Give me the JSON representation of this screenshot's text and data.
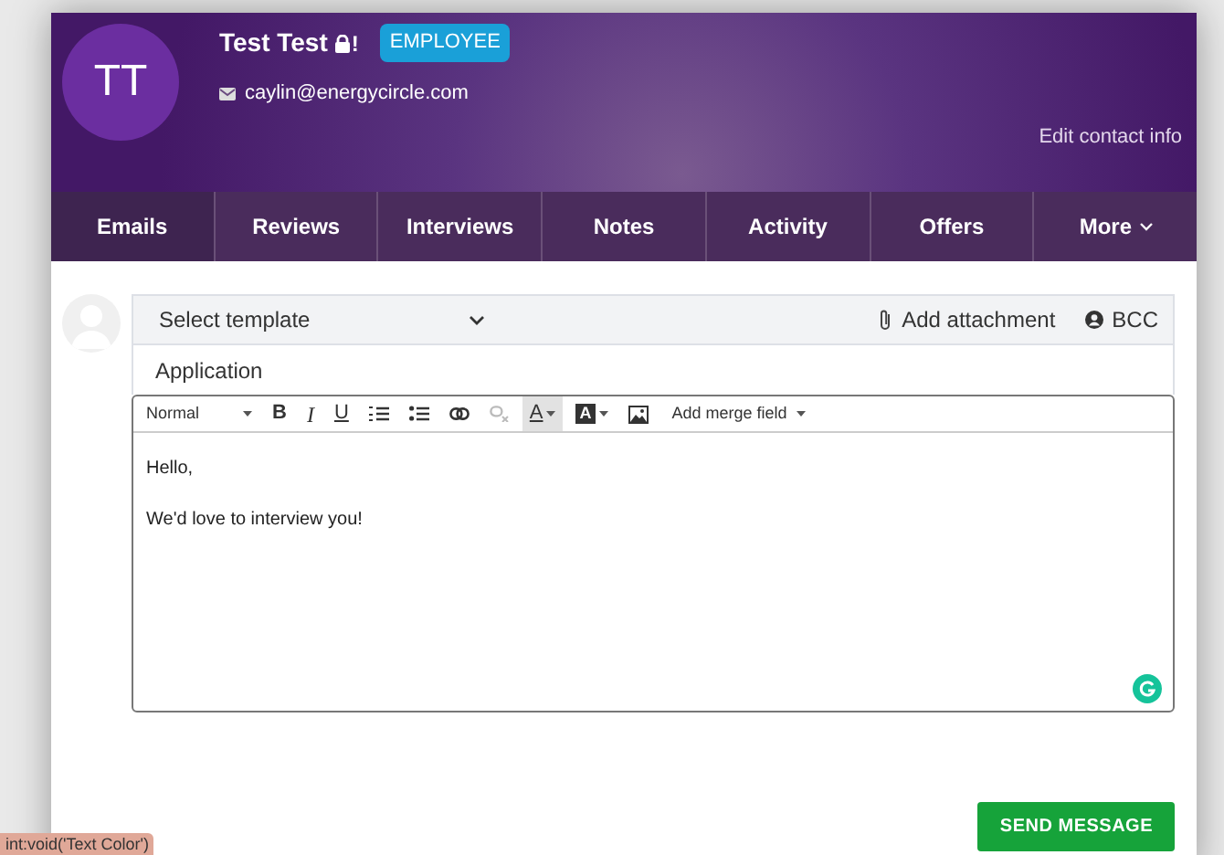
{
  "header": {
    "avatar_initials": "TT",
    "name": "Test Test",
    "locked_mark": "!",
    "badge": "EMPLOYEE",
    "email": "caylin@energycircle.com",
    "edit_link": "Edit contact info"
  },
  "tabs": [
    {
      "label": "Emails",
      "selected": true
    },
    {
      "label": "Reviews",
      "selected": false
    },
    {
      "label": "Interviews",
      "selected": false
    },
    {
      "label": "Notes",
      "selected": false
    },
    {
      "label": "Activity",
      "selected": false
    },
    {
      "label": "Offers",
      "selected": false
    },
    {
      "label": "More",
      "selected": false,
      "dropdown": true
    }
  ],
  "composer": {
    "template": "Select template",
    "attachment": "Add attachment",
    "bcc": "BCC",
    "subject": "Application",
    "toolbar": [
      {
        "kind": "format",
        "label": "Normal"
      },
      {
        "kind": "bold",
        "label": "B",
        "active": false,
        "disabled": false
      },
      {
        "kind": "italic",
        "label": "I",
        "active": false,
        "disabled": false
      },
      {
        "kind": "underline",
        "label": "U",
        "active": false,
        "disabled": false
      },
      {
        "kind": "ordered-list",
        "active": false,
        "disabled": false
      },
      {
        "kind": "bullet-list",
        "active": false,
        "disabled": false
      },
      {
        "kind": "link",
        "active": false,
        "disabled": false
      },
      {
        "kind": "unlink",
        "active": false,
        "disabled": true
      },
      {
        "kind": "text-color",
        "label": "A",
        "active": true,
        "disabled": false
      },
      {
        "kind": "background-color",
        "label": "A",
        "active": false,
        "disabled": false
      },
      {
        "kind": "image",
        "active": false,
        "disabled": false
      },
      {
        "kind": "merge",
        "label": "Add merge field"
      }
    ],
    "body": [
      "Hello,",
      "We'd love to interview you!"
    ],
    "send": "SEND MESSAGE"
  },
  "status_tooltip": "int:void('Text Color')"
}
